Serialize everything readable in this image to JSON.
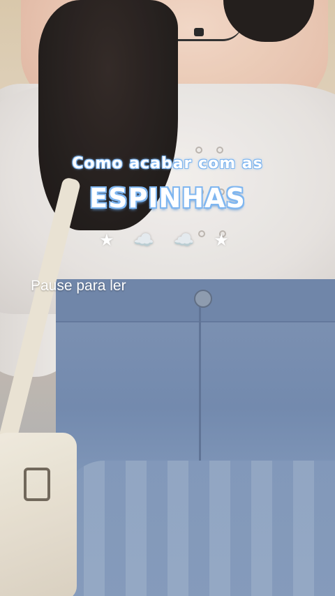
{
  "overlay": {
    "subtitle": "Como acabar com as",
    "title": "ESPINHAS",
    "decor": [
      "★",
      "☁️",
      "☁️",
      "★"
    ],
    "caption": "Pause para ler"
  },
  "colors": {
    "title_outline": "#7fb6f0",
    "text": "#ffffff"
  }
}
